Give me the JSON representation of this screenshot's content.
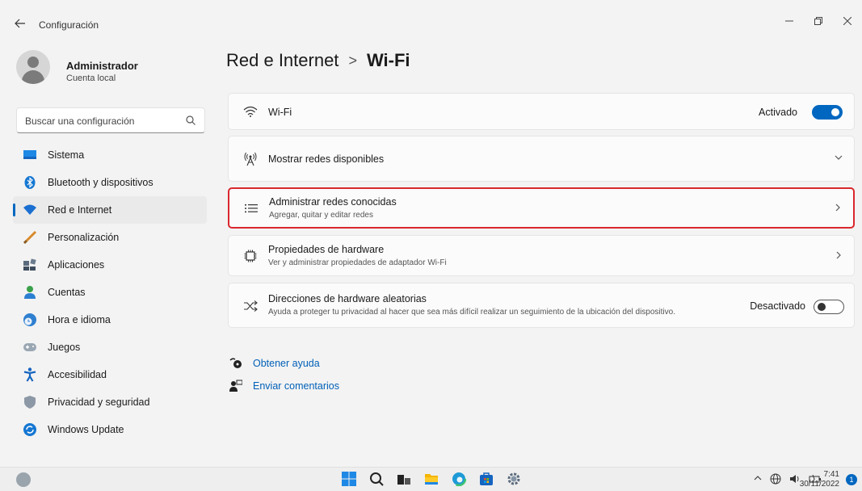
{
  "window": {
    "back_icon": "arrow-left-icon",
    "title": "Configuración",
    "controls": [
      "minimize-icon",
      "maximize-icon",
      "close-icon"
    ]
  },
  "user": {
    "name": "Administrador",
    "account_type": "Cuenta local"
  },
  "search": {
    "placeholder": "Buscar una configuración",
    "icon": "search-icon"
  },
  "sidebar": {
    "items": [
      {
        "label": "Sistema",
        "icon": "system-icon",
        "active": false
      },
      {
        "label": "Bluetooth y dispositivos",
        "icon": "bluetooth-icon",
        "active": false
      },
      {
        "label": "Red e Internet",
        "icon": "network-icon",
        "active": true
      },
      {
        "label": "Personalización",
        "icon": "brush-icon",
        "active": false
      },
      {
        "label": "Aplicaciones",
        "icon": "apps-icon",
        "active": false
      },
      {
        "label": "Cuentas",
        "icon": "accounts-icon",
        "active": false
      },
      {
        "label": "Hora e idioma",
        "icon": "time-language-icon",
        "active": false
      },
      {
        "label": "Juegos",
        "icon": "gamepad-icon",
        "active": false
      },
      {
        "label": "Accesibilidad",
        "icon": "accessibility-icon",
        "active": false
      },
      {
        "label": "Privacidad y seguridad",
        "icon": "shield-icon",
        "active": false
      },
      {
        "label": "Windows Update",
        "icon": "update-icon",
        "active": false
      }
    ]
  },
  "breadcrumb": {
    "parent": "Red e Internet",
    "separator": ">",
    "current": "Wi-Fi"
  },
  "cards": {
    "wifi": {
      "title": "Wi-Fi",
      "state_label": "Activado",
      "on": true
    },
    "networks": {
      "title": "Mostrar redes disponibles"
    },
    "known": {
      "title": "Administrar redes conocidas",
      "subtitle": "Agregar, quitar y editar redes"
    },
    "hardware": {
      "title": "Propiedades de hardware",
      "subtitle": "Ver y administrar propiedades de adaptador Wi-Fi"
    },
    "random": {
      "title": "Direcciones de hardware aleatorias",
      "subtitle": "Ayuda a proteger tu privacidad al hacer que sea más difícil realizar un seguimiento de la ubicación del dispositivo.",
      "state_label": "Desactivado",
      "on": false
    }
  },
  "links": {
    "help": "Obtener ayuda",
    "feedback": "Enviar comentarios"
  },
  "taskbar": {
    "time": "7:41",
    "date": "30/11/2022",
    "notification_count": "1"
  },
  "colors": {
    "accent": "#0067c0",
    "highlight": "#d9272d",
    "link": "#0060b8"
  }
}
